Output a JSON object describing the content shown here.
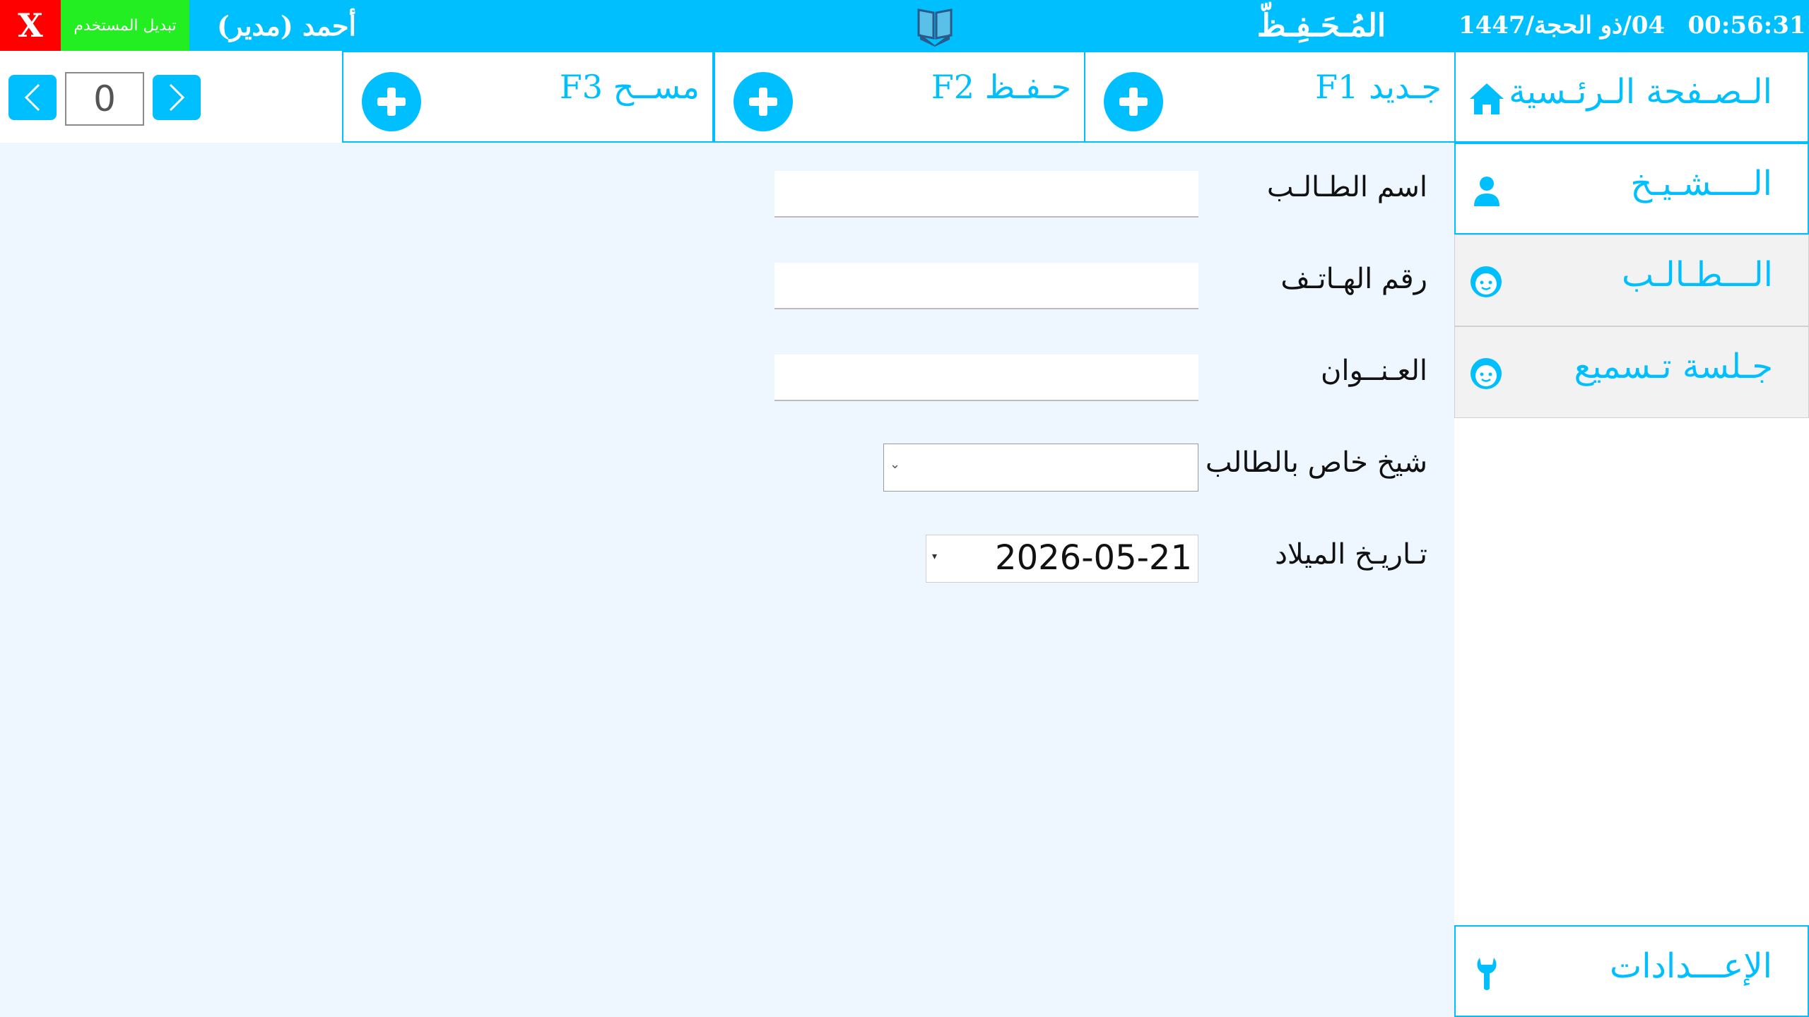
{
  "topbar": {
    "close_label": "X",
    "switch_user_label": "تبديل المستخدم",
    "user_name": "أحمد (مدير)",
    "app_title": "المُـحَـفِـظّ",
    "hijri_date": "04/ذو الحجة/1447",
    "clock": "00:56:31"
  },
  "pager": {
    "value": "0"
  },
  "toolbar": {
    "new_label": "جـديد F1",
    "save_label": "حـفـظ F2",
    "clear_label": "مســح F3"
  },
  "sidebar": {
    "home": "الـصـفحة الـرئـسية",
    "sheikh": "الــــشـيـخ",
    "student": "الـــطـالـب",
    "session": "جـلسة تـسميع",
    "settings": "الإعـــدادات"
  },
  "form": {
    "student_name_label": "اسم الطـالـب",
    "phone_label": "رقم الهـاتـف",
    "address_label": "العـنــوان",
    "sheikh_label": "شيخ خاص بالطالب",
    "birthdate_label": "تـاريـخ الميلاد",
    "birthdate_value": "2026-05-21"
  },
  "colors": {
    "accent": "#00bfff",
    "close": "#ff0000",
    "switch": "#22ee22",
    "background": "#eef6ff"
  }
}
